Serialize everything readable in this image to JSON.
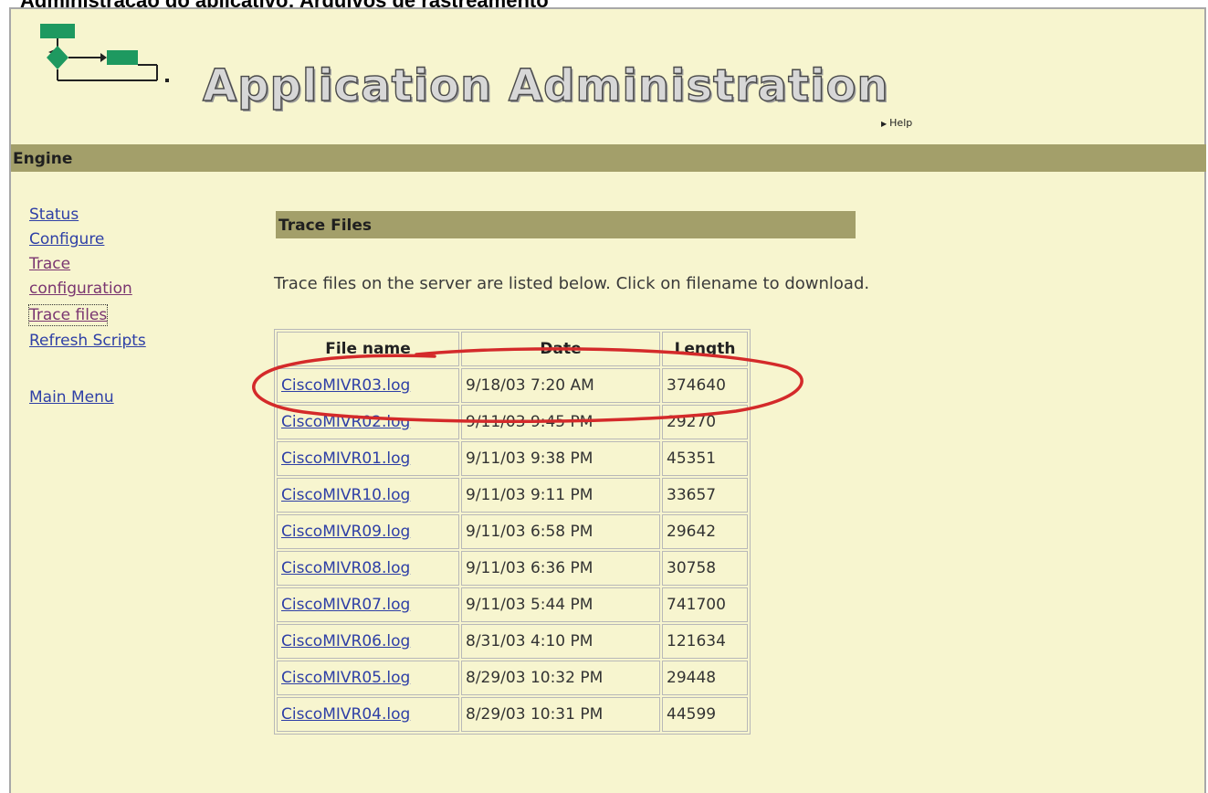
{
  "caption": "Administração do aplicativo: Arquivos de rastreamento",
  "header": {
    "app_title": "Application Administration",
    "help_label": "Help",
    "logo_icon": "workflow-logo-icon"
  },
  "engine_bar": {
    "label": "Engine"
  },
  "sidebar": {
    "items": [
      {
        "label": "Status"
      },
      {
        "label": "Configure"
      },
      {
        "label": "Trace configuration"
      },
      {
        "label": "Trace files"
      },
      {
        "label": "Refresh Scripts"
      },
      {
        "label": "Main Menu"
      }
    ]
  },
  "main": {
    "section_title": "Trace Files",
    "instructions": "Trace files on the server are listed below. Click on filename to download.",
    "table": {
      "columns": [
        "File name",
        "Date",
        "Length"
      ],
      "rows": [
        {
          "file": "CiscoMIVR03.log",
          "date": "9/18/03 7:20 AM",
          "length": "374640"
        },
        {
          "file": "CiscoMIVR02.log",
          "date": "9/11/03 9:45 PM",
          "length": "29270"
        },
        {
          "file": "CiscoMIVR01.log",
          "date": "9/11/03 9:38 PM",
          "length": "45351"
        },
        {
          "file": "CiscoMIVR10.log",
          "date": "9/11/03 9:11 PM",
          "length": "33657"
        },
        {
          "file": "CiscoMIVR09.log",
          "date": "9/11/03 6:58 PM",
          "length": "29642"
        },
        {
          "file": "CiscoMIVR08.log",
          "date": "9/11/03 6:36 PM",
          "length": "30758"
        },
        {
          "file": "CiscoMIVR07.log",
          "date": "9/11/03 5:44 PM",
          "length": "741700"
        },
        {
          "file": "CiscoMIVR06.log",
          "date": "8/31/03 4:10 PM",
          "length": "121634"
        },
        {
          "file": "CiscoMIVR05.log",
          "date": "8/29/03 10:32 PM",
          "length": "29448"
        },
        {
          "file": "CiscoMIVR04.log",
          "date": "8/29/03 10:31 PM",
          "length": "44599"
        }
      ]
    }
  },
  "colors": {
    "page_bg": "#f7f5cf",
    "bar_bg": "#a39f6a",
    "link": "#2e3fa6",
    "highlight_ellipse": "#d42a2a"
  }
}
